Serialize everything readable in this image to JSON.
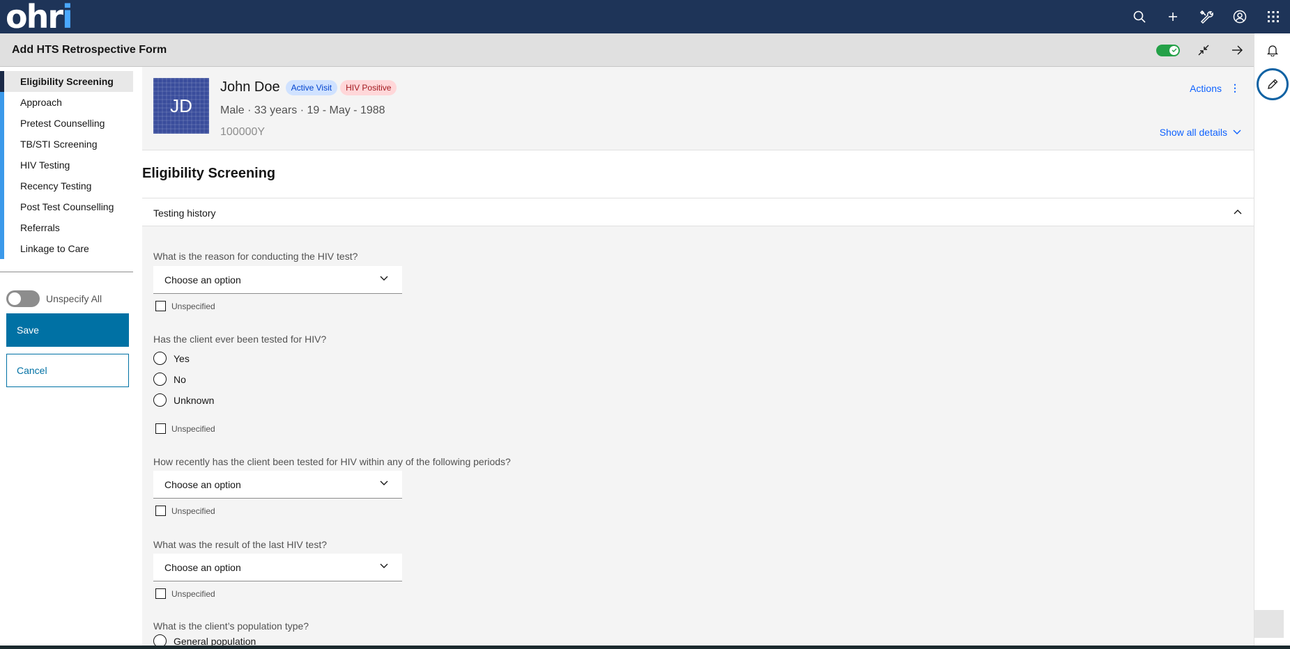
{
  "header": {
    "logo_text": "ohri",
    "icons": [
      "search-icon",
      "add-icon",
      "tools-icon",
      "user-icon",
      "app-switcher-icon"
    ]
  },
  "form": {
    "title": "Add HTS Retrospective Form",
    "title_icons": [
      "toggle-on-icon",
      "minimize-icon",
      "arrow-right-icon"
    ]
  },
  "rightrail": {
    "icons": [
      "bell-icon",
      "edit-pencil-icon"
    ]
  },
  "sidebar": {
    "items": [
      {
        "label": "Eligibility Screening",
        "active": true
      },
      {
        "label": "Approach"
      },
      {
        "label": "Pretest Counselling"
      },
      {
        "label": "TB/STI Screening"
      },
      {
        "label": "HIV Testing"
      },
      {
        "label": "Recency Testing"
      },
      {
        "label": "Post Test Counselling"
      },
      {
        "label": "Referrals"
      },
      {
        "label": "Linkage to Care"
      }
    ],
    "unspecify_all_label": "Unspecify All",
    "save_label": "Save",
    "cancel_label": "Cancel"
  },
  "patient": {
    "initials": "JD",
    "name": "John Doe",
    "tags": [
      "Active Visit",
      "HIV Positive"
    ],
    "meta": "Male · 33 years · 19 - May - 1988",
    "identifier": "100000Y",
    "actions_label": "Actions",
    "show_all_label": "Show all details"
  },
  "main": {
    "section_title": "Eligibility Screening",
    "accordion_label": "Testing history",
    "unspecified_label": "Unspecified",
    "questions": [
      {
        "label": "What is the reason for conducting the HIV test?",
        "type": "select",
        "value": "Choose an option"
      },
      {
        "label": "Has the client ever been tested for HIV?",
        "type": "radio",
        "options": [
          "Yes",
          "No",
          "Unknown"
        ]
      },
      {
        "label": "How recently has the client been tested for HIV within any of the following periods?",
        "type": "select",
        "value": "Choose an option"
      },
      {
        "label": "What was the result of the last HIV test?",
        "type": "select",
        "value": "Choose an option"
      },
      {
        "label": "What is the client’s population type?",
        "type": "radio",
        "options": [
          "General population"
        ]
      }
    ]
  },
  "colors": {
    "header_bg": "#1e3458",
    "primary_button": "#0071a4",
    "nav_accent": "#3b99ea",
    "nav_active_accent": "#1a2947",
    "link_blue": "#0f62fe",
    "toggle_on": "#24a148"
  }
}
